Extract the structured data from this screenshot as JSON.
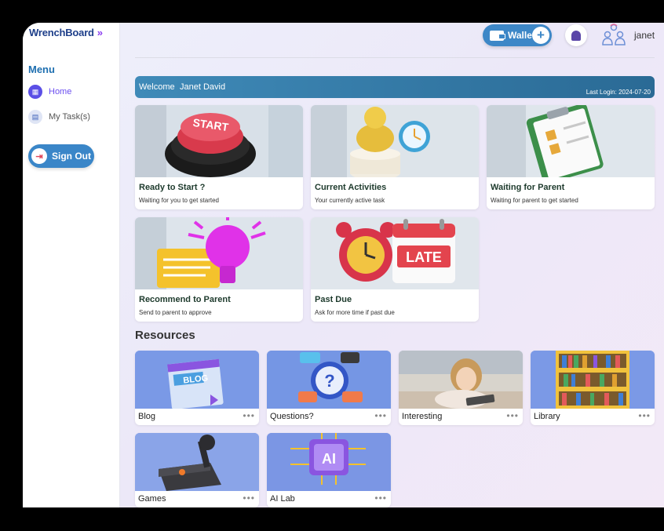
{
  "app": {
    "logo": "WrenchBoard",
    "logo_chevron": "»"
  },
  "sidebar": {
    "menu_title": "Menu",
    "items": [
      {
        "label": "Home",
        "active": true
      },
      {
        "label": "My Task(s)",
        "active": false
      }
    ],
    "signout_label": "Sign Out"
  },
  "header": {
    "wallet_label": "Wallet",
    "wallet_plus": "+",
    "username": "janet"
  },
  "welcome": {
    "label": "Welcome",
    "name": "Janet David",
    "last_login": "Last Login: 2024-07-20"
  },
  "tasks": [
    {
      "title": "Ready to Start ?",
      "subtitle": "Waiting for you to get started"
    },
    {
      "title": "Current Activities",
      "subtitle": "Your currently active task"
    },
    {
      "title": "Waiting for Parent",
      "subtitle": "Waiting for parent to get started"
    },
    {
      "title": "Recommend to Parent",
      "subtitle": "Send to parent to approve"
    },
    {
      "title": "Past Due",
      "subtitle": "Ask for more time if past due"
    }
  ],
  "task_images": {
    "start_button_text": "START",
    "late_text": "LATE"
  },
  "resources": {
    "title": "Resources",
    "items": [
      {
        "label": "Blog",
        "more": "•••"
      },
      {
        "label": "Questions?",
        "more": "•••"
      },
      {
        "label": "Interesting",
        "more": "•••"
      },
      {
        "label": "Library",
        "more": "•••"
      },
      {
        "label": "Games",
        "more": "•••"
      },
      {
        "label": "AI Lab",
        "more": "•••"
      }
    ],
    "blog_image_text": "BLOG",
    "ai_image_text": "AI",
    "question_mark": "?"
  },
  "colors": {
    "accent": "#3d87c7",
    "banner": "#2f7aa8",
    "purple": "#5b4fe6"
  }
}
